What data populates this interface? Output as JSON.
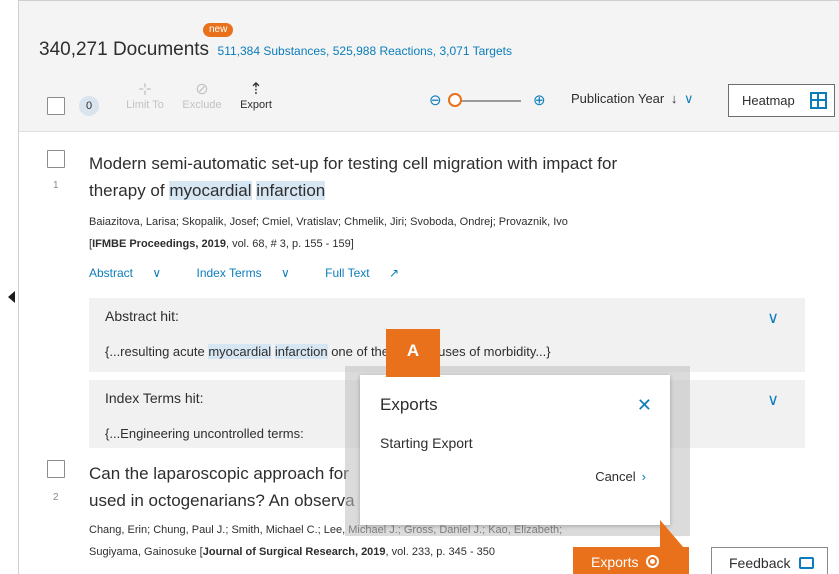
{
  "header": {
    "new_badge": "new",
    "documents_count": "340,271 Documents",
    "substances": "511,384 Substances,",
    "reactions": "525,988 Reactions,",
    "targets": "3,071 Targets"
  },
  "toolbar": {
    "selected_count": "0",
    "limit_to": "Limit To",
    "exclude": "Exclude",
    "export": "Export",
    "sort_label": "Publication Year",
    "heatmap": "Heatmap"
  },
  "results": [
    {
      "number": "1",
      "title_line1": "Modern semi-automatic set-up for testing cell migration with impact for",
      "title_line2_pre": "therapy of ",
      "title_hl1": "myocardial",
      "title_hl2": "infarction",
      "authors": "Baiazitova, Larisa; Skopalik, Josef; Cmiel, Vratislav; Chmelik, Jiri; Svoboda, Ondrej; Provaznik, Ivo",
      "source_open": "[",
      "source_journal": "IFMBE Proceedings, 2019",
      "source_rest": ", vol. 68, # 3, p. 155 - 159]",
      "link_abstract": "Abstract",
      "link_index_terms": "Index Terms",
      "link_full_text": "Full Text",
      "abstract_hit_title": "Abstract hit:",
      "abstract_hit_pre": "{...resulting acute ",
      "abstract_hit_hl1": "myocardial",
      "abstract_hit_hl2": "infarction",
      "abstract_hit_post": " one of the main causes of morbidity...}",
      "index_hit_title": "Index Terms hit:",
      "index_hit_text": "{...Engineering uncontrolled terms:"
    },
    {
      "number": "2",
      "title_line1": "Can the laparoscopic approach for",
      "title_line2": "used in octogenarians? An observa",
      "authors": "Chang, Erin; Chung, Paul J.; Smith, Michael C.; Lee, Michael J.; Gross, Daniel J.; Kao, Elizabeth;",
      "source_pre": "Sugiyama, Gainosuke [",
      "source_journal": "Journal of Surgical Research, 2019",
      "source_rest": ", vol. 233, p. 345 - 350"
    }
  ],
  "modal": {
    "marker": "A",
    "title": "Exports",
    "status": "Starting Export",
    "cancel": "Cancel"
  },
  "footer": {
    "exports": "Exports",
    "feedback": "Feedback"
  },
  "icons": {
    "limit": "crosshair-icon",
    "exclude": "ban-icon",
    "export": "upload-icon",
    "zoom_out": "zoom-out-icon",
    "zoom_in": "zoom-in-icon",
    "heatmap": "grid-icon",
    "close": "close-icon"
  },
  "colors": {
    "accent_orange": "#e9711c",
    "link_blue": "#0c7dbb",
    "highlight": "#d7e6f3"
  }
}
